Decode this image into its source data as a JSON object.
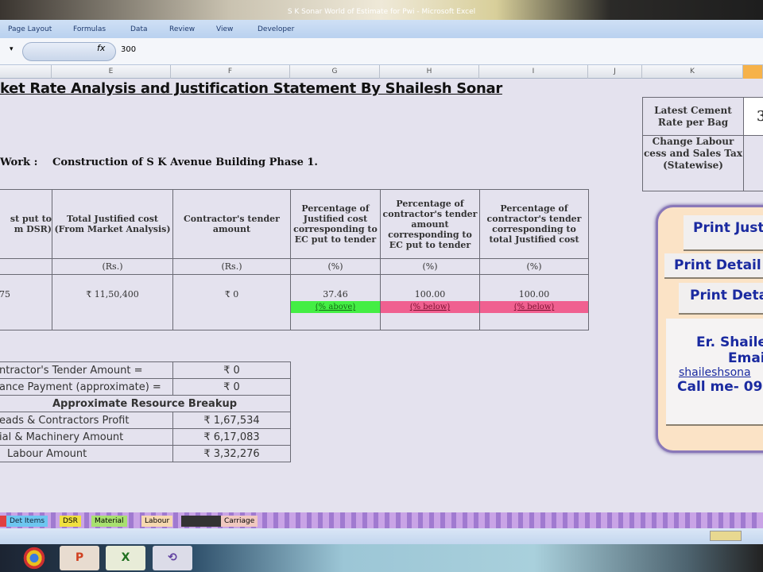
{
  "window": {
    "title": "S K Sonar World of Estimate for Pwi - Microsoft Excel"
  },
  "ribbon": {
    "tabs": [
      "Page Layout",
      "Formulas",
      "Data",
      "Review",
      "View",
      "Developer"
    ]
  },
  "formula_bar": {
    "fx": "fx",
    "value": "300"
  },
  "columns": [
    "E",
    "F",
    "G",
    "H",
    "I",
    "J",
    "K"
  ],
  "sheet": {
    "title": "ket Rate Analysis and Justification Statement By Shailesh Sonar",
    "work_label": "Work :",
    "work_value": "Construction of S K Avenue Building Phase 1.",
    "main_table": {
      "headers": [
        "st put to m DSR)",
        "Total Justified cost (From Market Analysis)",
        "Contractor's tender amount",
        "Percentage of Justified cost corresponding to EC put to tender",
        "Percentage of contractor's tender amount corresponding to EC put to tender",
        "Percentage of contractor's tender corresponding to total Justified cost"
      ],
      "units": [
        "",
        "(Rs.)",
        "(Rs.)",
        "(%)",
        "(%)",
        "(%)"
      ],
      "values": [
        "75",
        "₹ 11,50,400",
        "₹ 0",
        "37.46",
        "100.00",
        "100.00"
      ],
      "badges": [
        "(% above)",
        "(% below)",
        "(% below)"
      ],
      "badge_colors": [
        "#44ee44",
        "#f06090",
        "#f06090"
      ]
    },
    "summary": [
      {
        "label": "ntractor's Tender Amount =",
        "value": "₹ 0"
      },
      {
        "label": "ance Payment (approximate) =",
        "value": "₹ 0"
      },
      {
        "label": "Approximate Resource Breakup",
        "value": ""
      },
      {
        "label": "eads & Contractors Profit",
        "value": "₹ 1,67,534"
      },
      {
        "label": "ial & Machinery Amount",
        "value": "₹ 6,17,083"
      },
      {
        "label": "Labour Amount",
        "value": "₹ 3,32,276"
      }
    ],
    "right_table": {
      "cement_label": "Latest Cement Rate per Bag",
      "cement_value": "3",
      "labour_label": "Change Labour cess and Sales Tax (Statewise)"
    },
    "panel": {
      "btn1": "Print Just",
      "btn2": "Print Detail",
      "btn3": "Print Deta",
      "name": "Er. Shaile",
      "email_label": "Emai",
      "email": "shaileshsona",
      "call": "Call me- 09"
    }
  },
  "sheet_tabs": [
    "Det Items",
    "DSR",
    "Material",
    "Labour",
    "Carriage"
  ],
  "sheet_tab_colors": [
    "#6ec6f0",
    "#f0e040",
    "#a8e070",
    "#f6d8b0",
    "#f0c8c0"
  ]
}
